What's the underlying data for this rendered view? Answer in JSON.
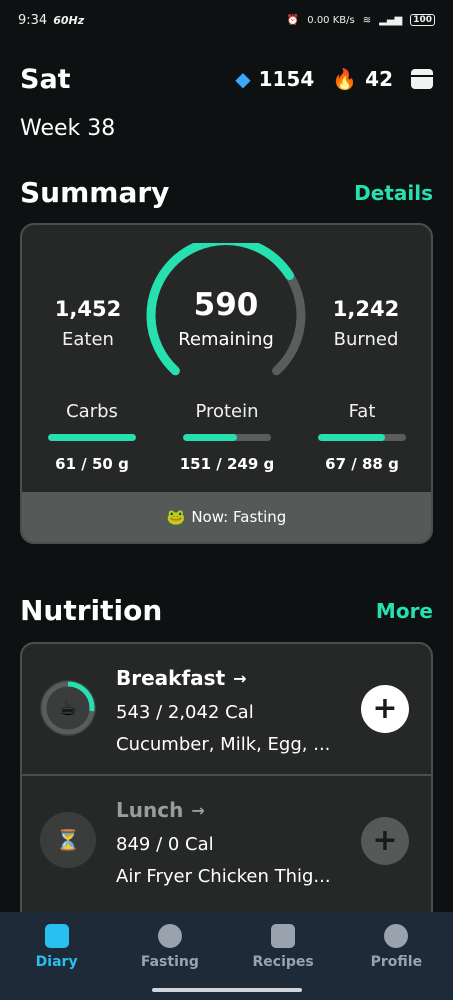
{
  "status": {
    "time": "9:34",
    "refresh": "60Hz",
    "speed": "0.00 KB/s",
    "battery": "100"
  },
  "header": {
    "day": "Sat",
    "gems": "1154",
    "streak": "42",
    "week": "Week 38"
  },
  "summary": {
    "title": "Summary",
    "link": "Details",
    "eaten_value": "1,452",
    "eaten_label": "Eaten",
    "remaining_value": "590",
    "remaining_label": "Remaining",
    "remaining_progress": 0.71,
    "burned_value": "1,242",
    "burned_label": "Burned",
    "macros": [
      {
        "name": "Carbs",
        "value": "61 / 50 g",
        "progress": 1.0
      },
      {
        "name": "Protein",
        "value": "151 / 249 g",
        "progress": 0.61
      },
      {
        "name": "Fat",
        "value": "67 / 88 g",
        "progress": 0.76
      }
    ],
    "fasting_emoji": "🐸",
    "fasting_text": "Now: Fasting"
  },
  "nutrition": {
    "title": "Nutrition",
    "link": "More",
    "meals": [
      {
        "name": "Breakfast",
        "arrow": "→",
        "cal": "543 / 2,042 Cal",
        "items": "Cucumber, Milk, Egg, ...",
        "emoji": "☕",
        "progress": 0.27
      },
      {
        "name": "Lunch",
        "arrow": "→",
        "cal": "849 / 0 Cal",
        "items": "Air Fryer Chicken Thig...",
        "emoji": "⏳",
        "progress": 0
      }
    ]
  },
  "nav": {
    "items": [
      {
        "label": "Diary"
      },
      {
        "label": "Fasting"
      },
      {
        "label": "Recipes"
      },
      {
        "label": "Profile"
      }
    ]
  },
  "colors": {
    "accent": "#27e0b0",
    "nav_active": "#27c0f0",
    "card_bg": "#262827",
    "page_bg": "#0e1111"
  }
}
